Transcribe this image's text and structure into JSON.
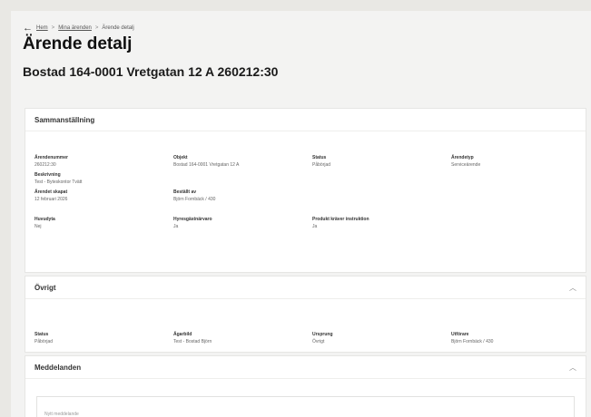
{
  "breadcrumb": {
    "home": "Hem",
    "level2": "Mina ärenden",
    "current": "Ärende detalj"
  },
  "page": {
    "title": "Ärende detalj",
    "subtitle": "Bostad 164-0001 Vretgatan 12 A 260212:30"
  },
  "summary": {
    "heading": "Sammanställning",
    "fields": [
      {
        "label": "Ärendenummer",
        "value": "260212:30"
      },
      {
        "label": "Objekt",
        "value": "Bostad 164-0001 Vretgatan 12 A"
      },
      {
        "label": "Status",
        "value": "Påbörjad"
      },
      {
        "label": "Ärendetyp",
        "value": "Serviceärende"
      },
      {
        "label": "Beskrivning",
        "value": "Test - Byteskontor Tvätt"
      },
      {
        "label": "Ärendet skapat",
        "value": "12 februari 2026"
      },
      {
        "label": "Beställt av",
        "value": "Björn Fornbäck / 430"
      },
      {
        "label": "Huvudyta",
        "value": "Nej"
      },
      {
        "label": "Hyresgästnärvaro",
        "value": "Ja"
      },
      {
        "label": "Produkt kräver instruktion",
        "value": "Ja"
      }
    ]
  },
  "other": {
    "heading": "Övrigt",
    "fields": [
      {
        "label": "Status",
        "value": "Påbörjad"
      },
      {
        "label": "Ägarbild",
        "value": "Test - Bostad Björn"
      },
      {
        "label": "Ursprung",
        "value": "Övrigt"
      },
      {
        "label": "Utförare",
        "value": "Björn Fornbäck / 430"
      }
    ]
  },
  "messages": {
    "heading": "Meddelanden",
    "placeholder": "Nytt meddelande"
  }
}
